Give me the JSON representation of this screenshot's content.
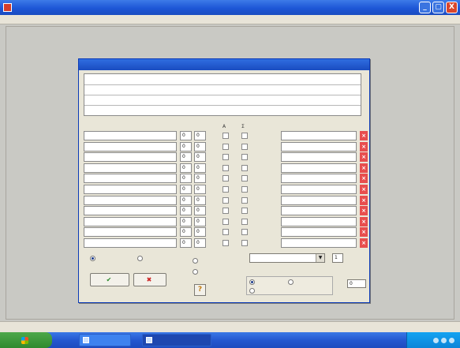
{
  "window": {
    "title": "",
    "minimize_label": "_",
    "maximize_label": "▢",
    "close_label": "X"
  },
  "menu": {
    "items": [
      "",
      "",
      "",
      "",
      "",
      ""
    ]
  },
  "dialog": {
    "title": "",
    "column_headers": {
      "field": "",
      "length": "",
      "from": "",
      "a": "A",
      "b": "Σ",
      "title": ""
    },
    "rows": [
      {
        "length": "0",
        "from": "0"
      },
      {
        "length": "0",
        "from": "0"
      },
      {
        "length": "0",
        "from": "0"
      },
      {
        "length": "0",
        "from": "0"
      },
      {
        "length": "0",
        "from": "0"
      },
      {
        "length": "0",
        "from": "0"
      },
      {
        "length": "0",
        "from": "0"
      },
      {
        "length": "0",
        "from": "0"
      },
      {
        "length": "0",
        "from": "0"
      },
      {
        "length": "0",
        "from": "0"
      },
      {
        "length": "0",
        "from": "0"
      }
    ],
    "delete_label": "×",
    "page_radio_1": "",
    "page_radio_2": "",
    "orient_radio_1": "",
    "orient_radio_2": "",
    "spin_value": "1",
    "save_button": "",
    "cancel_button": "",
    "help_label": "?",
    "scope_radio_1": "",
    "scope_radio_2": "",
    "scope_radio_3": "",
    "width_label": "",
    "width_value": "0"
  },
  "statusbar": {
    "left_text": "",
    "right_text": ""
  },
  "taskbar": {
    "start_label": "",
    "tasks": [
      {
        "label": ""
      },
      {
        "label": ""
      }
    ],
    "clock": ""
  },
  "colors": {
    "titlebar": "#1d56d6",
    "dialog_bg": "#e9e6d8",
    "delete_red": "#e84e4e",
    "start_green": "#2f8a2f"
  }
}
